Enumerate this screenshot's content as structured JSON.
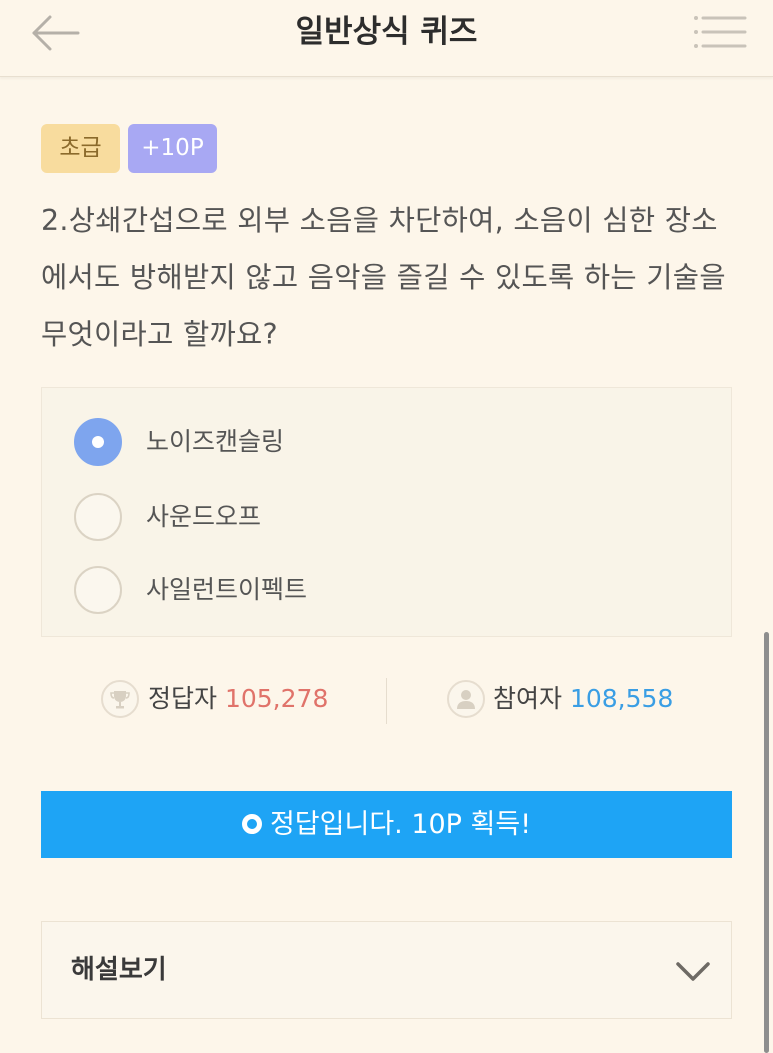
{
  "header": {
    "title": "일반상식 퀴즈",
    "back_icon": "back-arrow-icon",
    "menu_icon": "menu-list-icon"
  },
  "quiz": {
    "level_badge": "초급",
    "points_badge": "+10P",
    "question": "2.상쇄간섭으로 외부 소음을 차단하여, 소음이 심한 장소에서도 방해받지 않고 음악을 즐길 수 있도록 하는 기술을 무엇이라고 할까요?",
    "options": [
      {
        "label": "노이즈캔슬링",
        "selected": true
      },
      {
        "label": "사운드오프",
        "selected": false
      },
      {
        "label": "사일런트이펙트",
        "selected": false
      }
    ]
  },
  "stats": {
    "correct_label": "정답자",
    "correct_count": "105,278",
    "participants_label": "참여자",
    "participants_count": "108,558",
    "correct_icon": "trophy-icon",
    "participants_icon": "user-icon"
  },
  "result": {
    "message": "정답입니다. 10P 획득!",
    "icon": "target-circle-icon"
  },
  "explanation": {
    "label": "해설보기",
    "icon": "chevron-down-icon"
  },
  "colors": {
    "background": "#fdf6ea",
    "accent_blue": "#1ea4f5",
    "radio_selected": "#7ea5ee",
    "count_red": "#e0736a",
    "count_blue": "#3a9ee4",
    "level_badge_bg": "#f8dc9e",
    "points_badge_bg": "#a8a8f3"
  }
}
